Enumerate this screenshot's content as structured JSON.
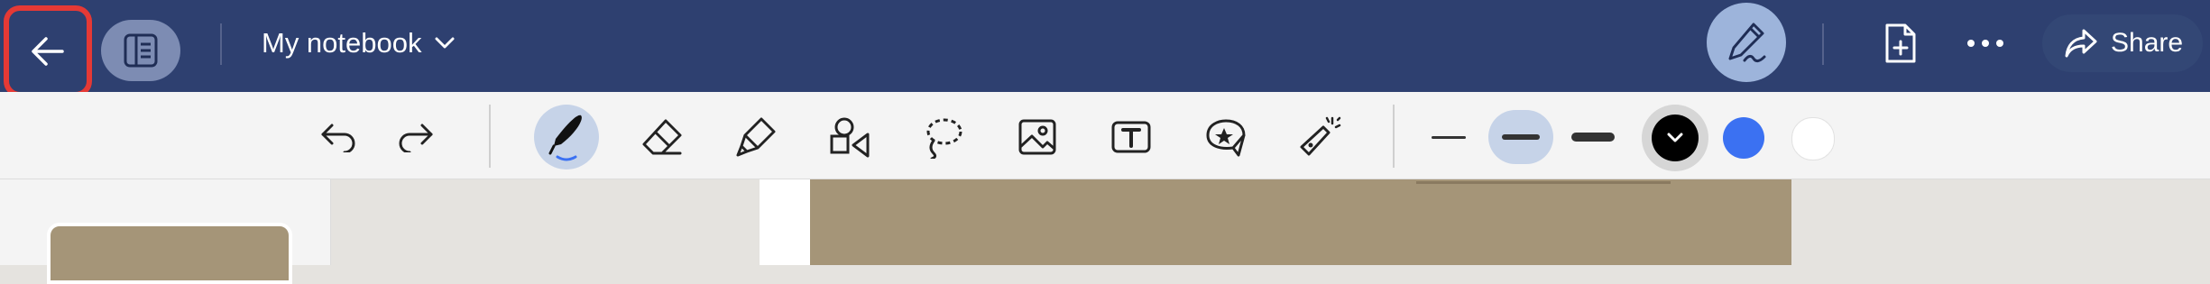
{
  "header": {
    "notebook_title": "My notebook",
    "share_label": "Share",
    "icons": {
      "back": "arrow-left-icon",
      "sidebar": "notebook-sidebar-icon",
      "dropdown": "chevron-down-icon",
      "pen_mode": "pen-signature-icon",
      "add_page": "file-plus-icon",
      "more": "more-dots-icon",
      "share": "share-arrow-icon"
    }
  },
  "toolbar": {
    "tools": [
      "undo-icon",
      "redo-icon",
      "pen-icon",
      "eraser-icon",
      "highlighter-icon",
      "shapes-icon",
      "lasso-icon",
      "image-icon",
      "text-box-icon",
      "sticker-icon",
      "laser-pointer-icon"
    ],
    "active_tool": "pen-icon",
    "stroke_sizes": [
      "thin",
      "medium",
      "thick"
    ],
    "active_stroke": "medium",
    "colors": [
      {
        "name": "black",
        "hex": "#000000",
        "selected": true
      },
      {
        "name": "blue",
        "hex": "#3b71f2",
        "selected": false
      },
      {
        "name": "white",
        "hex": "#ffffff",
        "selected": false
      }
    ]
  },
  "theme": {
    "header_bg": "#2e4070",
    "accent_highlight": "#c6d3e8",
    "focus_outline": "#e53935",
    "page_color": "#a59578"
  }
}
